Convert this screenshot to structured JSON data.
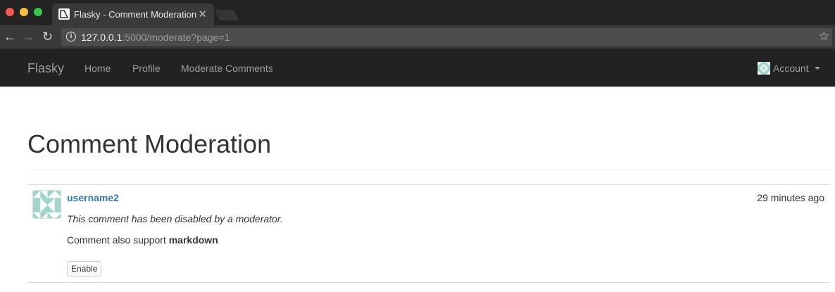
{
  "browser": {
    "tab_title": "Flasky - Comment Moderation",
    "tab_close": "✕",
    "url_host": "127.0.0.1",
    "url_rest": ":5000/moderate?page=1",
    "back_icon": "←",
    "forward_icon": "→",
    "reload_icon": "↻",
    "info_icon": "i",
    "star_icon": "☆"
  },
  "navbar": {
    "brand": "Flasky",
    "links": [
      "Home",
      "Profile",
      "Moderate Comments"
    ],
    "account_label": "Account"
  },
  "page": {
    "title": "Comment Moderation"
  },
  "comments": [
    {
      "author": "username2",
      "timestamp": "29 minutes ago",
      "disabled_notice": "This comment has been disabled by a moderator.",
      "body_prefix": "Comment also support ",
      "body_bold": "markdown",
      "action_label": "Enable"
    }
  ],
  "colors": {
    "navbar_bg": "#222222",
    "link": "#337ab7",
    "identicon": "#9fd5cd"
  }
}
